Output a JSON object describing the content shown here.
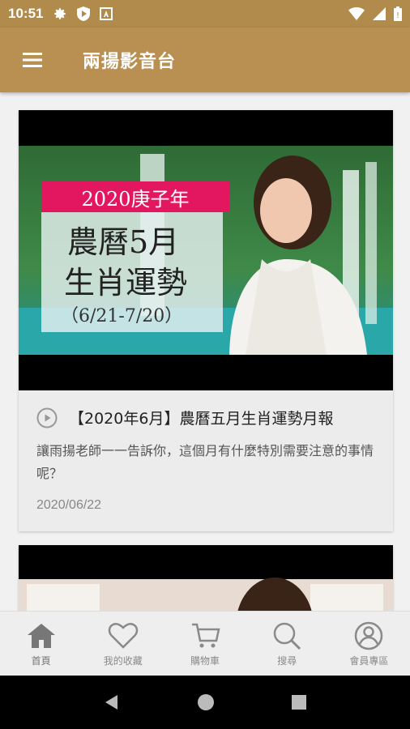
{
  "status_bar": {
    "time": "10:51"
  },
  "app_bar": {
    "title": "兩揚影音台"
  },
  "cards": [
    {
      "thumbnail": {
        "banner": "2020庚子年",
        "headline_1": "農曆5月",
        "headline_2": "生肖運勢",
        "range": "（6/21-7/20）"
      },
      "title": "【2020年6月】農曆五月生肖運勢月報",
      "description": "讓雨揚老師一一告訴你，這個月有什麼特別需要注意的事情呢？",
      "date": "2020/06/22"
    }
  ],
  "bottom_nav": [
    {
      "label": "首頁",
      "icon": "home-icon"
    },
    {
      "label": "我的收藏",
      "icon": "heart-icon"
    },
    {
      "label": "購物車",
      "icon": "cart-icon"
    },
    {
      "label": "搜尋",
      "icon": "search-icon"
    },
    {
      "label": "會員專區",
      "icon": "account-icon"
    }
  ],
  "colors": {
    "status_bar": "#b08b4c",
    "app_bar": "#b98f52",
    "nav_icon": "#8a8a8a"
  }
}
